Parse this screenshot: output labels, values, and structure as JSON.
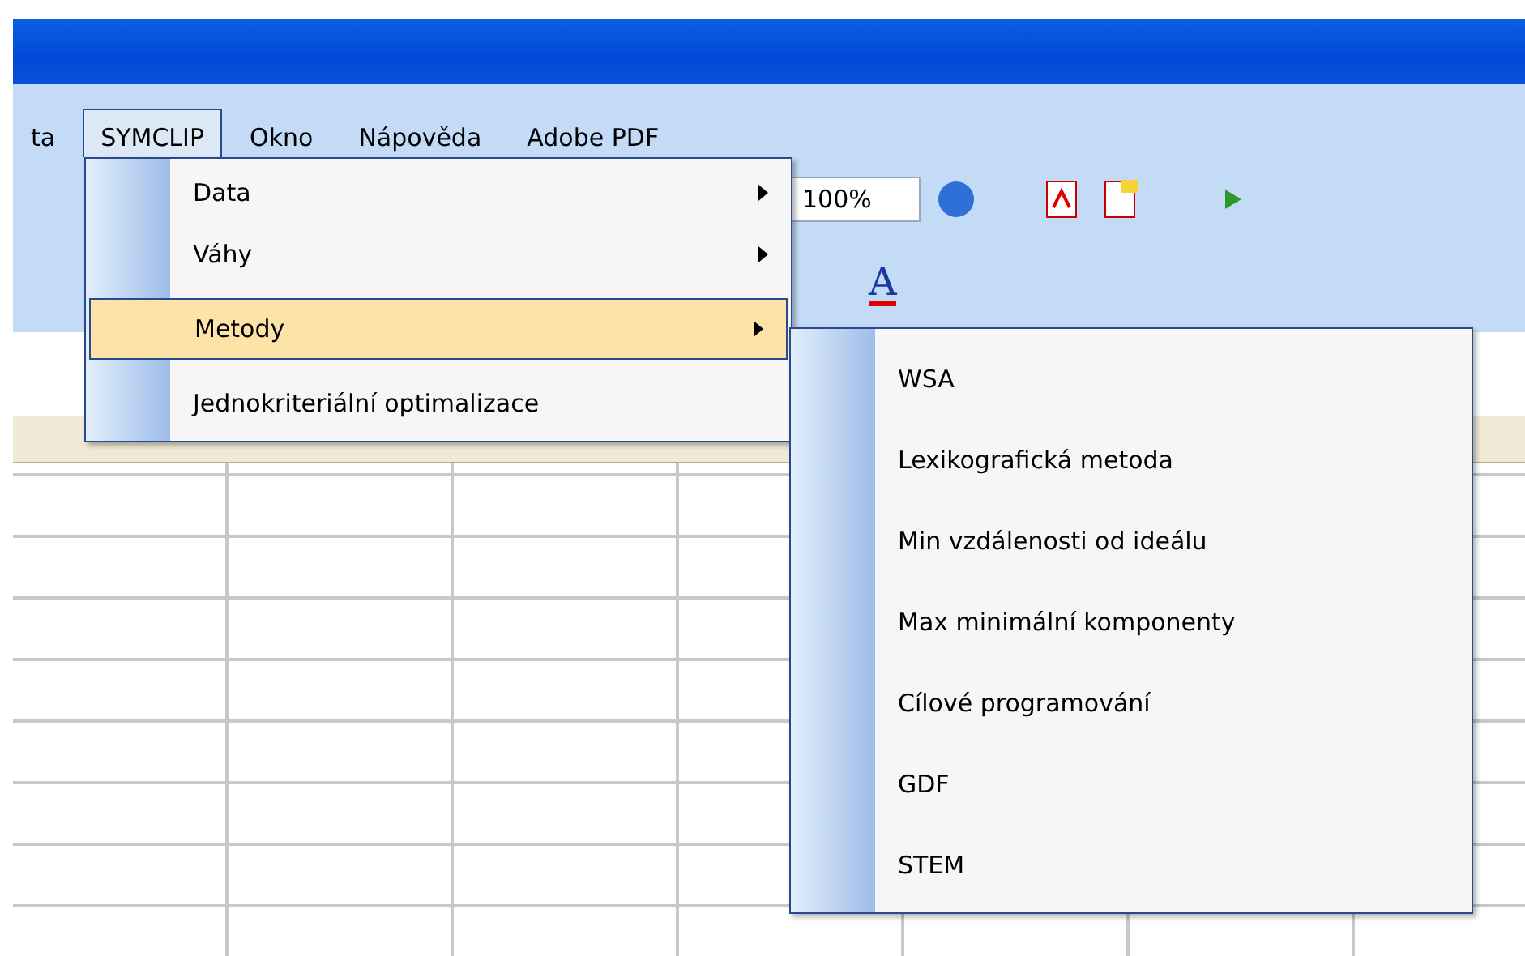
{
  "menu_bar": [
    {
      "label": "ta",
      "selected": false
    },
    {
      "label": "SYMCLIP",
      "selected": true
    },
    {
      "label": "Okno",
      "selected": false
    },
    {
      "label": "Nápověda",
      "selected": false
    },
    {
      "label": "Adobe PDF",
      "selected": false
    }
  ],
  "toolbar": {
    "zoom": "100%",
    "font_color_glyph": "A"
  },
  "menu": {
    "items": [
      {
        "label": "Data",
        "submenu": true,
        "selected": false
      },
      {
        "label": "Váhy",
        "submenu": true,
        "selected": false
      },
      {
        "label": "Metody",
        "submenu": true,
        "selected": true
      },
      {
        "label": "Jednokriteriální optimalizace",
        "submenu": false,
        "selected": false
      }
    ]
  },
  "submenu": {
    "items": [
      {
        "label": "WSA"
      },
      {
        "label": "Lexikografická metoda"
      },
      {
        "label": "Min vzdálenosti od ideálu"
      },
      {
        "label": "Max minimální komponenty"
      },
      {
        "label": "Cílové programování"
      },
      {
        "label": "GDF"
      },
      {
        "label": "STEM"
      }
    ]
  }
}
